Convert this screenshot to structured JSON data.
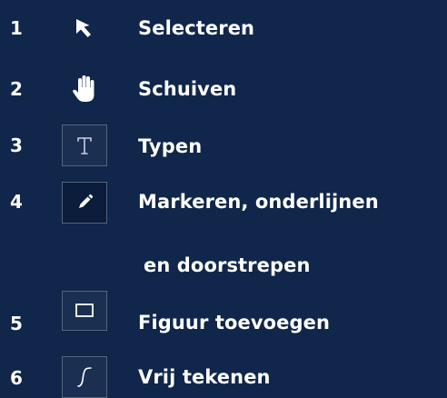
{
  "tools": [
    {
      "number": "1",
      "label": "Selecteren",
      "icon": "arrow-cursor-icon"
    },
    {
      "number": "2",
      "label": "Schuiven",
      "icon": "hand-icon"
    },
    {
      "number": "3",
      "label": "Typen",
      "icon": "text-t-icon"
    },
    {
      "number": "4",
      "label": "Markeren, onderlijnen",
      "label_line2": "en doorstrepen",
      "icon": "pencil-icon"
    },
    {
      "number": "5",
      "label": "Figuur toevoegen",
      "icon": "rectangle-icon"
    },
    {
      "number": "6",
      "label": "Vrij tekenen",
      "icon": "freehand-curve-icon"
    }
  ],
  "colors": {
    "background": "#10264a",
    "text": "#ffffff",
    "icon_border": "#55657e",
    "icon_box": "#1a2f52"
  }
}
